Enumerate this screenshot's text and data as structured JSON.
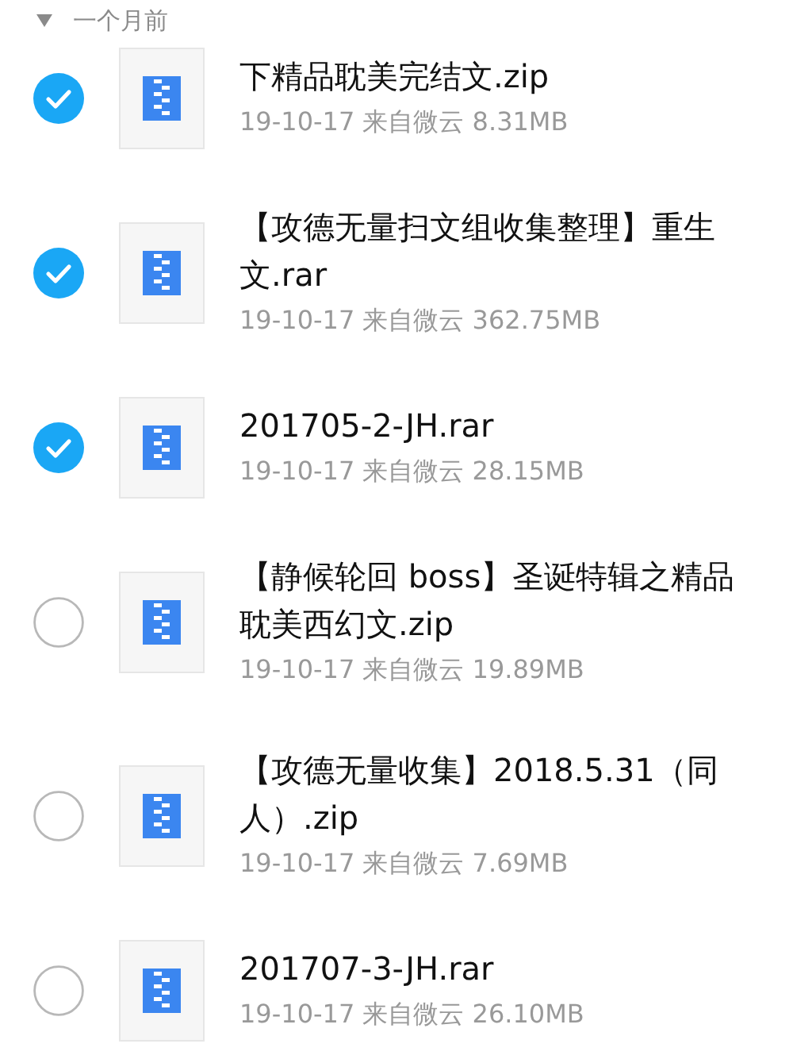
{
  "section": {
    "title": "一个月前",
    "expanded": true
  },
  "files": [
    {
      "name": "下精品耽美完结文.zip",
      "meta": "19-10-17 来自微云 8.31MB",
      "selected": true
    },
    {
      "name": "【攻德无量扫文组收集整理】重生文.rar",
      "meta": "19-10-17 来自微云 362.75MB",
      "selected": true
    },
    {
      "name": "201705-2-JH.rar",
      "meta": "19-10-17 来自微云 28.15MB",
      "selected": true
    },
    {
      "name": "【静候轮回 boss】圣诞特辑之精品耽美西幻文.zip",
      "meta": "19-10-17 来自微云 19.89MB",
      "selected": false
    },
    {
      "name": "【攻德无量收集】2018.5.31（同人）.zip",
      "meta": "19-10-17 来自微云 7.69MB",
      "selected": false
    },
    {
      "name": "201707-3-JH.rar",
      "meta": "19-10-17 来自微云 26.10MB",
      "selected": false
    }
  ]
}
